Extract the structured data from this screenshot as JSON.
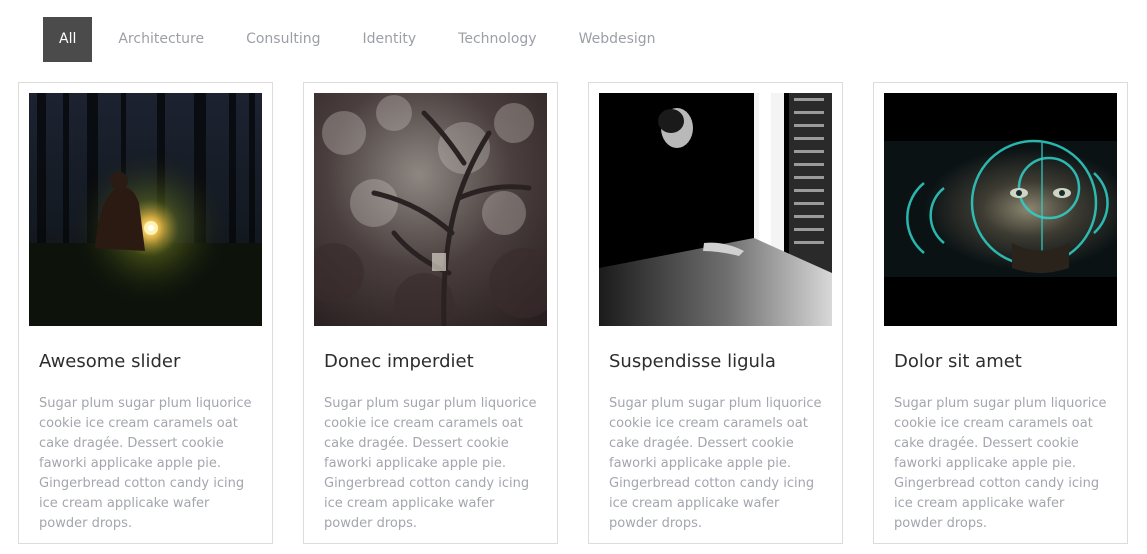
{
  "filters": [
    {
      "label": "All",
      "active": true
    },
    {
      "label": "Architecture",
      "active": false
    },
    {
      "label": "Consulting",
      "active": false
    },
    {
      "label": "Identity",
      "active": false
    },
    {
      "label": "Technology",
      "active": false
    },
    {
      "label": "Webdesign",
      "active": false
    }
  ],
  "cards": [
    {
      "title": "Awesome slider",
      "description": "Sugar plum sugar plum liquorice cookie ice cream caramels oat cake dragée. Dessert cookie faworki applicake apple pie. Gingerbread cotton candy icing ice cream applicake wafer powder drops.",
      "image": "person-with-lantern-in-forest"
    },
    {
      "title": "Donec imperdiet",
      "description": "Sugar plum sugar plum liquorice cookie ice cream caramels oat cake dragée. Dessert cookie faworki applicake apple pie. Gingerbread cotton candy icing ice cream applicake wafer powder drops.",
      "image": "blurred-tree-branches"
    },
    {
      "title": "Suspendisse ligula",
      "description": "Sugar plum sugar plum liquorice cookie ice cream caramels oat cake dragée. Dessert cookie faworki applicake apple pie. Gingerbread cotton candy icing ice cream applicake wafer powder drops.",
      "image": "man-by-bright-doorway"
    },
    {
      "title": "Dolor sit amet",
      "description": "Sugar plum sugar plum liquorice cookie ice cream caramels oat cake dragée. Dessert cookie faworki applicake apple pie. Gingerbread cotton candy icing ice cream applicake wafer powder drops.",
      "image": "face-with-hud-overlay"
    }
  ]
}
